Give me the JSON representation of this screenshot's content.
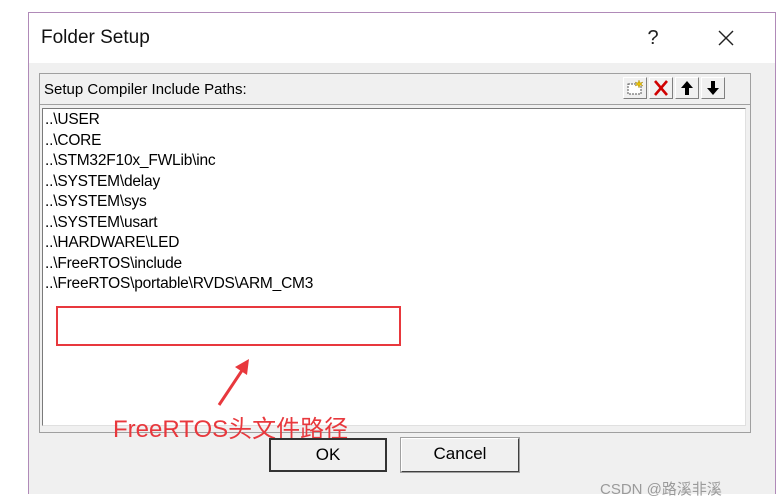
{
  "window": {
    "title": "Folder Setup",
    "help_label": "?"
  },
  "group": {
    "label": "Setup Compiler Include Paths:"
  },
  "toolbar": {
    "icons": [
      "new-folder-icon",
      "delete-icon",
      "move-up-icon",
      "move-down-icon"
    ]
  },
  "paths": [
    "..\\USER",
    "..\\CORE",
    "..\\STM32F10x_FWLib\\inc",
    "..\\SYSTEM\\delay",
    "..\\SYSTEM\\sys",
    "..\\SYSTEM\\usart",
    "..\\HARDWARE\\LED",
    "..\\FreeRTOS\\include",
    "..\\FreeRTOS\\portable\\RVDS\\ARM_CM3"
  ],
  "annotation": {
    "text": "FreeRTOS头文件路径",
    "color": "#e8383d"
  },
  "buttons": {
    "ok": "OK",
    "cancel": "Cancel"
  },
  "watermark": "CSDN @路溪非溪"
}
